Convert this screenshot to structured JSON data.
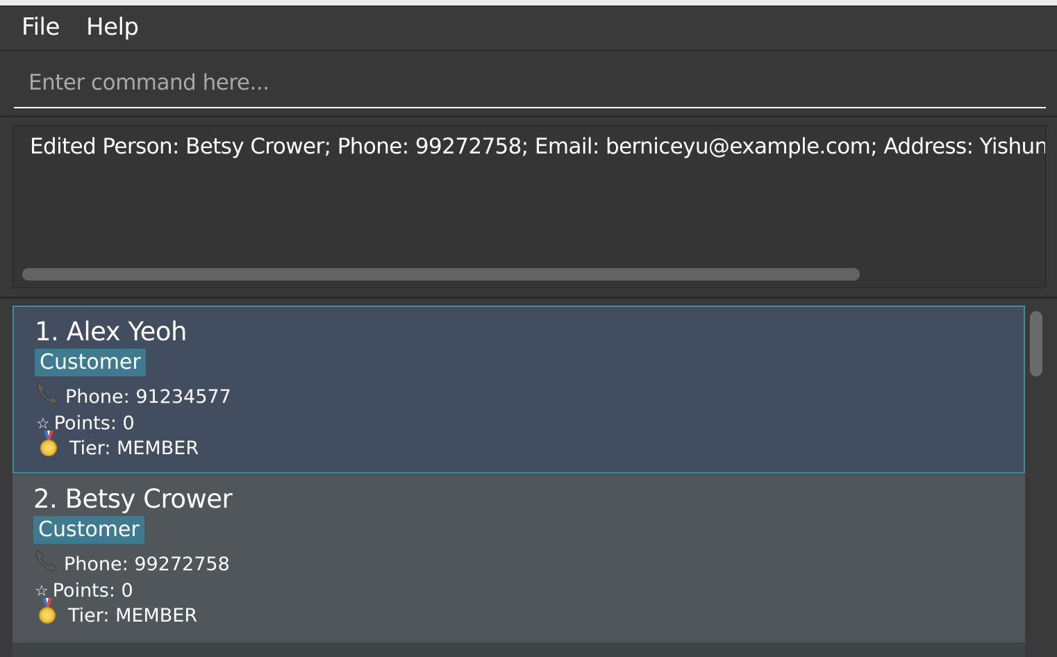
{
  "menu": {
    "file_label": "File",
    "help_label": "Help"
  },
  "command_box": {
    "placeholder": "Enter command here..."
  },
  "result_display": {
    "text": "Edited Person: Betsy Crower; Phone: 99272758; Email: berniceyu@example.com; Address: Yishun; C"
  },
  "person_list": {
    "persons": [
      {
        "name": "1. Alex Yeoh",
        "tag": "Customer",
        "phone": "Phone: 91234577",
        "points": "Points: 0",
        "tier": "Tier: MEMBER"
      },
      {
        "name": "2. Betsy Crower",
        "tag": "Customer",
        "phone": "Phone: 99272758",
        "points": "Points: 0",
        "tier": "Tier: MEMBER"
      }
    ]
  },
  "colors": {
    "selected_card": "#424d5f",
    "selected_border": "#3b8ea3",
    "card": "#50565a",
    "tag": "#3e7b91"
  },
  "icons": {
    "phone": "phone-icon",
    "points": "star-icon",
    "tier": "medal-icon"
  }
}
